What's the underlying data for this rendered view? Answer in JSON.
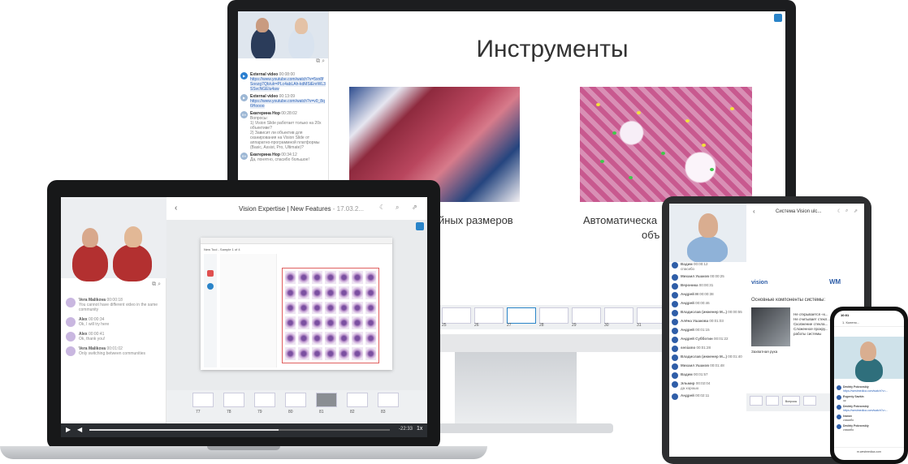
{
  "monitor": {
    "chat": [
      {
        "name": "External video",
        "time": "00:08:00",
        "text": "https://www.youtube.com/watch?v=5xn8fSoozg7Qb/ulr=PLc4abLAh-kdMSiEnrWL3SSvcNGElu4aw",
        "type": "link"
      },
      {
        "name": "External video",
        "time": "00:13:09",
        "text": "https://www.youtube.com/watch?v=v0_8q6Hoooo",
        "type": "link"
      },
      {
        "name": "Екатерина Нор",
        "time": "00:28:02",
        "text": "Вопросы:\n1) Vision Slide работает только на 20х объективе?\n2) Зависит ли объектив для сканирования на Vision Slide от аппаратно-программной платформы (Basic, Assist, Pro, Ultimate)?",
        "type": "text"
      },
      {
        "name": "Екатерина Нор",
        "time": "00:34:12",
        "text": "Да, понятно, спасибо большое!",
        "type": "text"
      }
    ],
    "slide": {
      "title": "Инструменты",
      "caption_left": "йных размеров",
      "caption_right_1": "Автоматическа",
      "caption_right_2": "объ"
    },
    "thumbs": [
      "25",
      "26",
      "27",
      "28",
      "29",
      "30",
      "31"
    ]
  },
  "laptop": {
    "title": "Vision Expertise | New Features",
    "date": " - 17.03.2...",
    "app_title": "New Tool - Sample 1 of 4",
    "chat": [
      {
        "name": "Vera Malikova",
        "time": "00:00:18",
        "text": "You cannot have different video in the same community"
      },
      {
        "name": "Alex",
        "time": "00:00:34",
        "text": "Ok, I will try here"
      },
      {
        "name": "Alex",
        "time": "00:00:41",
        "text": "Ok, thank you!"
      },
      {
        "name": "Vera Malikova",
        "time": "00:01:02",
        "text": "Only switching between communities"
      }
    ],
    "thumb_nums": [
      "77",
      "78",
      "79",
      "80",
      "81",
      "82",
      "83"
    ],
    "player": {
      "time": "-22:33",
      "speed": "1x",
      "progress": 0.63
    }
  },
  "tablet": {
    "title": "Система Vision ulc...",
    "brand_left": "vision",
    "brand_right": "WM",
    "heading": "Основные компоненты системы:",
    "bullets": [
      "Не открывается «к...",
      "Не считывает стекл...",
      "Сколжение стекла...",
      "Сложенное прокру...",
      "работы системы"
    ],
    "caption": "Захватная рука",
    "chat": [
      {
        "name": "Вадим",
        "time": "00:00:12",
        "text": "спасибо"
      },
      {
        "name": "Михаил Ушаков",
        "time": "00:00:25",
        "text": ""
      },
      {
        "name": "Вероника",
        "time": "00:00:31",
        "text": ""
      },
      {
        "name": "Андрей М",
        "time": "00:00:38",
        "text": ""
      },
      {
        "name": "Андрей",
        "time": "00:00:46",
        "text": ""
      },
      {
        "name": "Владислав (инженер M...)",
        "time": "00:00:55",
        "text": ""
      },
      {
        "name": "Алёна Ушакова",
        "time": "00:01:03",
        "text": ""
      },
      {
        "name": "Андрей",
        "time": "00:01:15",
        "text": ""
      },
      {
        "name": "Андрей Субботин",
        "time": "00:01:22",
        "text": ""
      },
      {
        "name": "seniamo",
        "time": "00:01:28",
        "text": ""
      },
      {
        "name": "Владислав (инженер M...)",
        "time": "00:01:40",
        "text": ""
      },
      {
        "name": "Михаил Ушаков",
        "time": "00:01:48",
        "text": ""
      },
      {
        "name": "Вадим",
        "time": "00:01:57",
        "text": ""
      },
      {
        "name": "Эльмир",
        "time": "00:02:04",
        "text": "да хорошо"
      },
      {
        "name": "Андрей",
        "time": "00:02:11",
        "text": ""
      }
    ],
    "thumbs": [
      "Вопросы"
    ]
  },
  "phone": {
    "time": "10:01",
    "tab_title": "1. Колено...",
    "url": "m.westmedica.com",
    "chat": [
      {
        "name": "Dmitriy Pokrovskiy",
        "text": "https://westmedica.com/watch?v=..."
      },
      {
        "name": "Evgeniy Savkin",
        "text": "ок"
      },
      {
        "name": "Dmitriy Pokrovskiy",
        "text": "https://westmedica.com/watch?v=..."
      },
      {
        "name": "Ivanov",
        "text": "спасибо"
      },
      {
        "name": "Dmitriy Pokrovskiy",
        "text": "спасибо"
      }
    ]
  },
  "colors": {
    "accent": "#2a84c9",
    "brand": "#2f5ea8",
    "dark": "#1c1d1f"
  }
}
